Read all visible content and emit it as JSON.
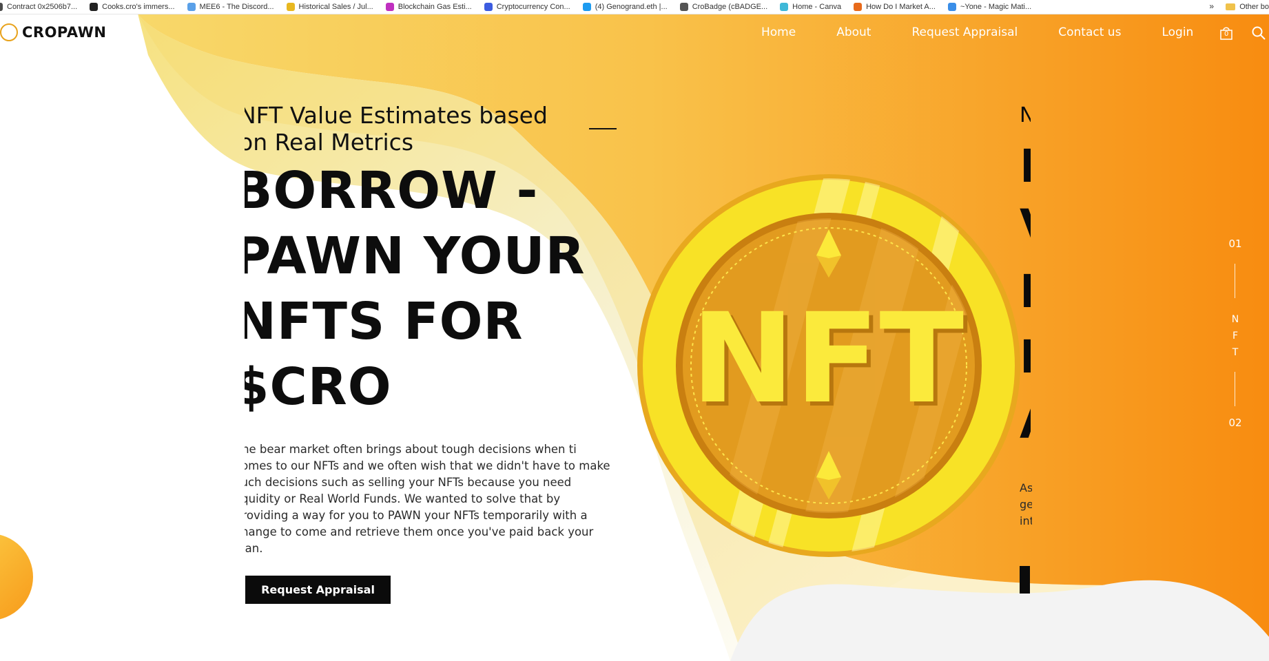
{
  "bookmarks": [
    {
      "label": "Contract 0x2506b7...",
      "color": "#4a4a4a"
    },
    {
      "label": "Cooks.cro's immers...",
      "color": "#222222"
    },
    {
      "label": "MEE6 - The Discord...",
      "color": "#5aa0e8"
    },
    {
      "label": "Historical Sales / Jul...",
      "color": "#e8b820"
    },
    {
      "label": "Blockchain Gas Esti...",
      "color": "#c030c0"
    },
    {
      "label": "Cryptocurrency Con...",
      "color": "#3c5ce0"
    },
    {
      "label": "(4) Genogrand.eth |...",
      "color": "#1d9bf0"
    },
    {
      "label": "CroBadge (cBADGE...",
      "color": "#555555"
    },
    {
      "label": "Home - Canva",
      "color": "#3fb8d8"
    },
    {
      "label": "How Do I Market A...",
      "color": "#e86a1a"
    },
    {
      "label": "~Yone - Magic Mati...",
      "color": "#3a8ee8"
    }
  ],
  "bookmarks_more": "»",
  "bookmarks_other": "Other bo",
  "logo": {
    "text": "CROPAWN"
  },
  "nav": {
    "home": "Home",
    "about": "About",
    "request": "Request Appraisal",
    "contact": "Contact us",
    "login": "Login",
    "cart_count": "0"
  },
  "hero": {
    "subtitle": "NFT Value Estimates based on Real Metrics",
    "headline": "BORROW - PAWN YOUR NFTS FOR $CRO",
    "body": "The bear market often brings about tough decisions when ti comes to our NFTs and we often wish that we didn't have to make such decisions such as selling your NFTs because you need liquidity or Real World Funds. We wanted to solve that by providing a way for you to PAWN your NFTs temporarily with a change to come and retrieve them once you've paid back your loan.",
    "cta": "Request Appraisal",
    "coin_text": "NFT"
  },
  "next_slide": {
    "letters": [
      "N",
      "I",
      "V",
      "I",
      "I",
      "A"
    ],
    "text_lines": [
      "As",
      "ge",
      "int"
    ]
  },
  "slider": {
    "start": "01",
    "end": "02",
    "letters": [
      "N",
      "F",
      "T"
    ]
  },
  "colors": {
    "accent_orange": "#f7a21a",
    "accent_yellow": "#f7e25a",
    "coin_gold": "#e8a020",
    "dark": "#0b0b0b"
  }
}
